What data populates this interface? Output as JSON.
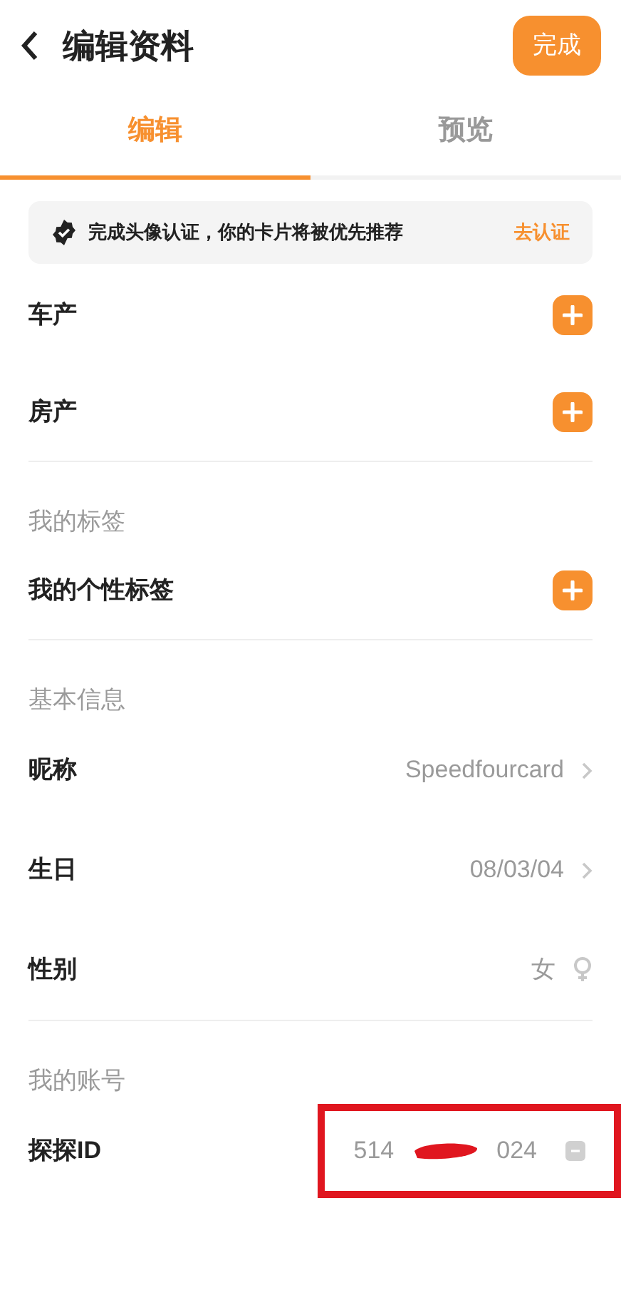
{
  "header": {
    "title": "编辑资料",
    "done_button": "完成"
  },
  "tabs": [
    {
      "label": "编辑",
      "selected": true
    },
    {
      "label": "预览",
      "selected": false
    }
  ],
  "banner": {
    "text": "完成头像认证，你的卡片将被优先推荐",
    "action": "去认证"
  },
  "sections": [
    {
      "rows": [
        {
          "kind": "add",
          "label": "车产"
        },
        {
          "kind": "add",
          "label": "房产"
        }
      ]
    },
    {
      "title": "我的标签",
      "rows": [
        {
          "kind": "add",
          "label": "我的个性标签"
        }
      ]
    },
    {
      "title": "基本信息",
      "rows": [
        {
          "kind": "value",
          "label": "昵称",
          "value": "Speedfourcard"
        },
        {
          "kind": "value",
          "label": "生日",
          "value": "08/03/04"
        },
        {
          "kind": "gender",
          "label": "性别",
          "value": "女"
        }
      ]
    },
    {
      "title": "我的账号",
      "rows": [
        {
          "kind": "account",
          "label": "探探ID",
          "value_start": "514",
          "value_end": "024",
          "highlighted": true
        }
      ]
    }
  ]
}
